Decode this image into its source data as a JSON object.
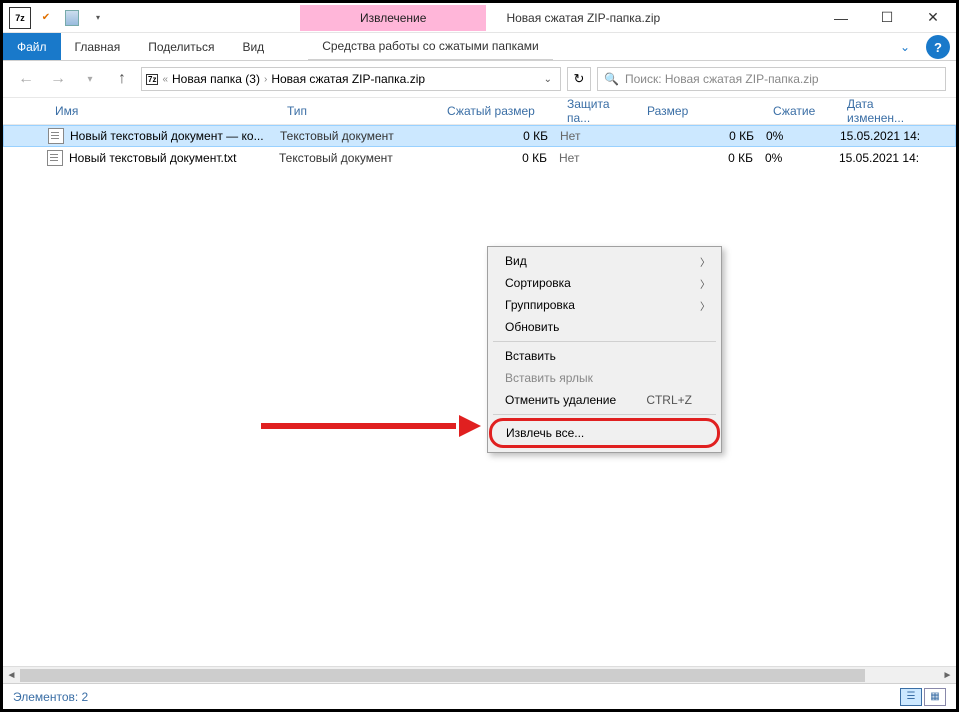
{
  "titlebar": {
    "contextual_tab": "Извлечение",
    "window_title": "Новая сжатая ZIP-папка.zip"
  },
  "ribbon": {
    "file": "Файл",
    "home": "Главная",
    "share": "Поделиться",
    "view": "Вид",
    "context_tools": "Средства работы со сжатыми папками"
  },
  "address": {
    "crumb1": "Новая папка (3)",
    "crumb2": "Новая сжатая ZIP-папка.zip",
    "search_placeholder": "Поиск: Новая сжатая ZIP-папка.zip"
  },
  "columns": {
    "name": "Имя",
    "type": "Тип",
    "csize": "Сжатый размер",
    "prot": "Защита па...",
    "size": "Размер",
    "compr": "Сжатие",
    "date": "Дата изменен..."
  },
  "rows": [
    {
      "name": "Новый текстовый документ — ко...",
      "type": "Текстовый документ",
      "csize": "0 КБ",
      "prot": "Нет",
      "size": "0 КБ",
      "compr": "0%",
      "date": "15.05.2021 14:"
    },
    {
      "name": "Новый текстовый документ.txt",
      "type": "Текстовый документ",
      "csize": "0 КБ",
      "prot": "Нет",
      "size": "0 КБ",
      "compr": "0%",
      "date": "15.05.2021 14:"
    }
  ],
  "context_menu": {
    "view": "Вид",
    "sort": "Сортировка",
    "group": "Группировка",
    "refresh": "Обновить",
    "paste": "Вставить",
    "paste_shortcut": "Вставить ярлык",
    "undo_delete": "Отменить удаление",
    "undo_shortcut": "CTRL+Z",
    "extract_all": "Извлечь все..."
  },
  "status": {
    "count_label": "Элементов: 2"
  }
}
